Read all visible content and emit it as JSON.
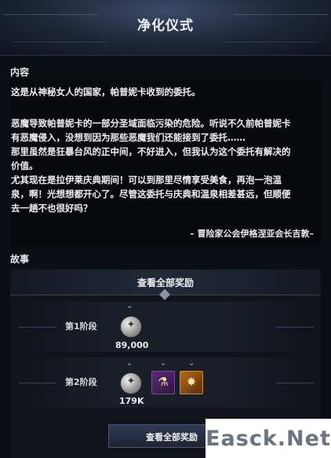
{
  "header": {
    "title": "净化仪式"
  },
  "content": {
    "label": "内容",
    "paragraph1": "这是从神秘女人的国家，帕普妮卡收到的委托。",
    "paragraph2": "恶魔导致帕普妮卡的一部分圣域面临污染的危险。听说不久前帕普妮卡\n有恶魔侵入，没想到因为那些恶魔我们还能接到了委托……\n那里虽然是狂暴台风的正中间，不好进入，但我认为这个委托有解决的\n价值。\n尤其现在是拉伊莱庆典期间！可以到那里尽情享受美食，再泡一泡温\n泉，啊！光想想都开心了。尽管这委托与庆典和温泉相差甚远，但顺便\n去一趟不也很好吗？",
    "signature": "– 冒险家公会伊格涅亚会长吉敦–"
  },
  "story": {
    "label": "故事"
  },
  "rewards": {
    "header": "查看全部奖励",
    "stages": [
      {
        "label": "第1阶段",
        "amount": "89,000",
        "icon": "silver-coin-icon"
      },
      {
        "label": "第2阶段",
        "amount": "179K",
        "icon": "silver-coin-icon",
        "extra_items": [
          {
            "icon": "purple-flask-item-icon",
            "color": "#5a2c7a"
          },
          {
            "icon": "orange-star-item-icon",
            "color": "#b66a1a"
          }
        ]
      }
    ],
    "bottom_button": "查看全部奖励"
  },
  "watermark": "Easck.Net",
  "colors": {
    "background": "#0b0e14",
    "panel": "#10131a",
    "accent": "#3a4255"
  }
}
